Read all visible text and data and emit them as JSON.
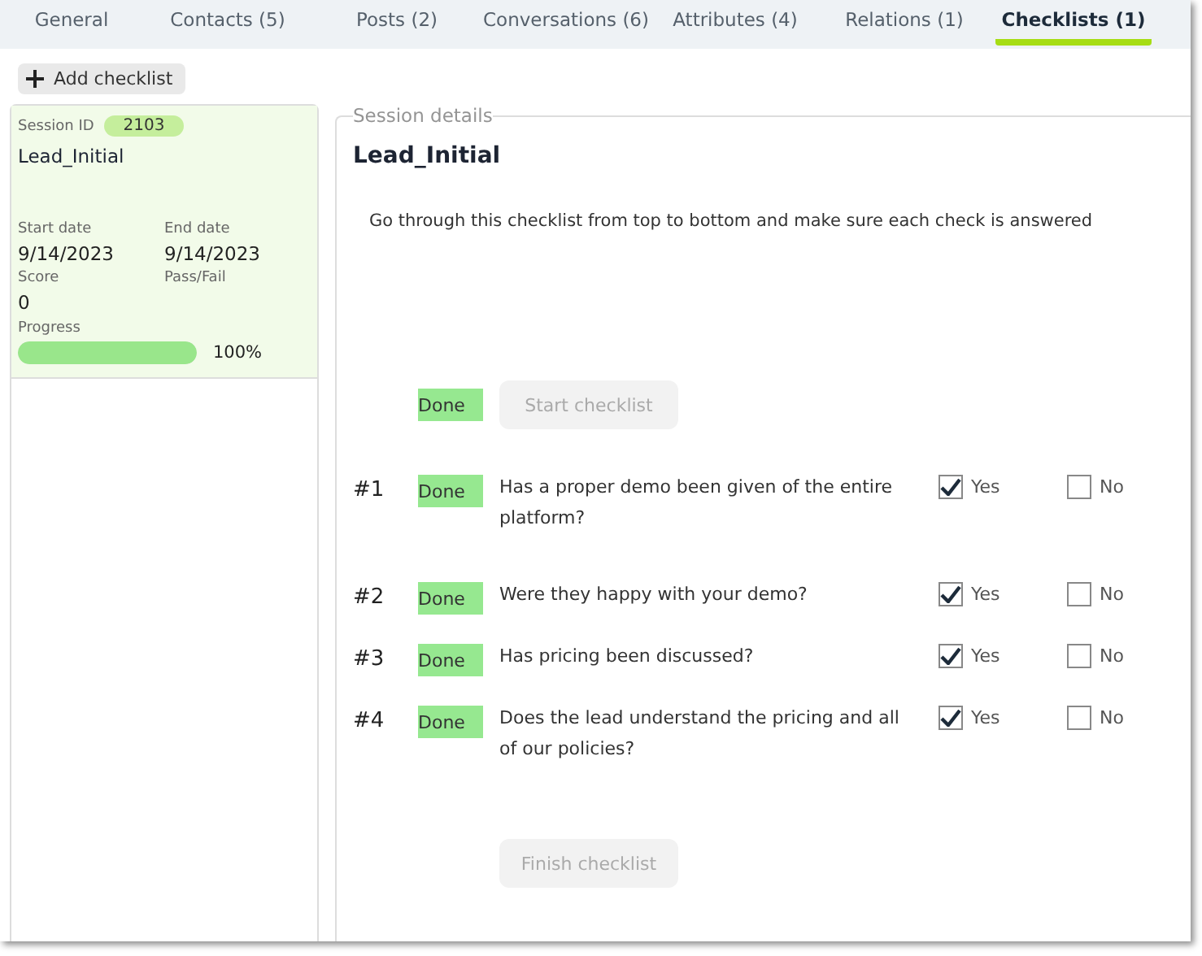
{
  "tabs": [
    {
      "label": "General",
      "selected": false
    },
    {
      "label": "Contacts (5)",
      "selected": false
    },
    {
      "label": "Posts (2)",
      "selected": false
    },
    {
      "label": "Conversations (6)",
      "selected": false
    },
    {
      "label": "Attributes (4)",
      "selected": false
    },
    {
      "label": "Relations (1)",
      "selected": false
    },
    {
      "label": "Checklists (1)",
      "selected": true
    }
  ],
  "add_button": {
    "label": "Add checklist"
  },
  "session_card": {
    "id_label": "Session ID",
    "id": "2103",
    "name": "Lead_Initial",
    "fields": [
      {
        "label": "Start date",
        "value": "9/14/2023"
      },
      {
        "label": "End date",
        "value": "9/14/2023"
      },
      {
        "label": "Score",
        "value": "0"
      },
      {
        "label": "Pass/Fail"
      }
    ],
    "progress_label": "Progress",
    "level": 1,
    "progress_text": "100%"
  },
  "details": {
    "legend": "Session details",
    "title": "Lead_Initial",
    "description": "Go through this checklist from top to bottom and make sure each check is answered",
    "start": {
      "status": "Done",
      "button": "Start checklist",
      "disabled": true
    },
    "questions": [
      {
        "number": "#1",
        "status": "Done",
        "text": "Has a proper demo been given of the entire platform?",
        "yes": {
          "label": "Yes",
          "checked": true
        },
        "no": {
          "label": "No",
          "checked": false
        }
      },
      {
        "number": "#2",
        "status": "Done",
        "text": "Were they happy with your demo?",
        "yes": {
          "label": "Yes",
          "checked": true
        },
        "no": {
          "label": "No",
          "checked": false
        }
      },
      {
        "number": "#3",
        "status": "Done",
        "text": "Has pricing been discussed?",
        "yes": {
          "label": "Yes",
          "checked": true
        },
        "no": {
          "label": "No",
          "checked": false
        }
      },
      {
        "number": "#4",
        "status": "Done",
        "text": "Does the lead understand the pricing and all of our policies?",
        "yes": {
          "label": "Yes",
          "checked": true
        },
        "no": {
          "label": "No",
          "checked": false
        }
      }
    ],
    "finish": {
      "button": "Finish checklist",
      "disabled": true
    }
  }
}
